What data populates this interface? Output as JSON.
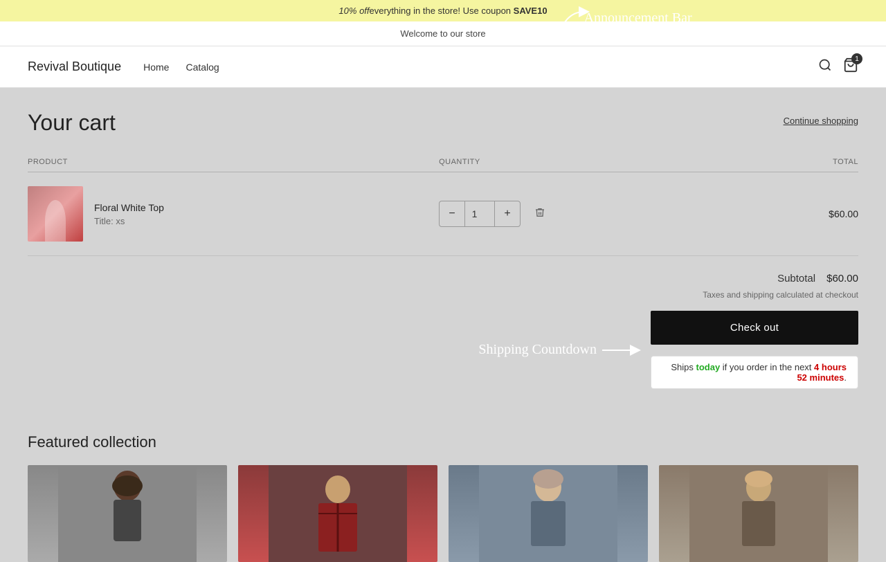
{
  "announcement": {
    "promo_prefix": "10% ",
    "promo_off": "off",
    "promo_suffix": "everything in the store! Use coupon ",
    "coupon_code": "SAVE10"
  },
  "welcome": {
    "text": "Welcome to our store"
  },
  "header": {
    "brand": "Revival Boutique",
    "nav": [
      {
        "label": "Home",
        "href": "#"
      },
      {
        "label": "Catalog",
        "href": "#"
      }
    ],
    "cart_count": "1"
  },
  "cart": {
    "title": "Your cart",
    "continue_shopping": "Continue shopping",
    "columns": {
      "product": "PRODUCT",
      "quantity": "QUANTITY",
      "total": "TOTAL"
    },
    "items": [
      {
        "name": "Floral White Top",
        "variant_label": "Title:",
        "variant_value": "xs",
        "quantity": 1,
        "price": "$60.00"
      }
    ],
    "subtotal_label": "Subtotal",
    "subtotal_amount": "$60.00",
    "tax_note": "Taxes and shipping calculated at checkout",
    "checkout_label": "Check out"
  },
  "shipping": {
    "prefix": "Ships ",
    "today": "today",
    "middle": " if you order in the next ",
    "time": "4 hours 52 minutes",
    "suffix": "."
  },
  "featured": {
    "title": "Featured collection"
  },
  "annotations": {
    "announcement_bar": "Announcement Bar",
    "shipping_countdown": "Shipping Countdown"
  }
}
